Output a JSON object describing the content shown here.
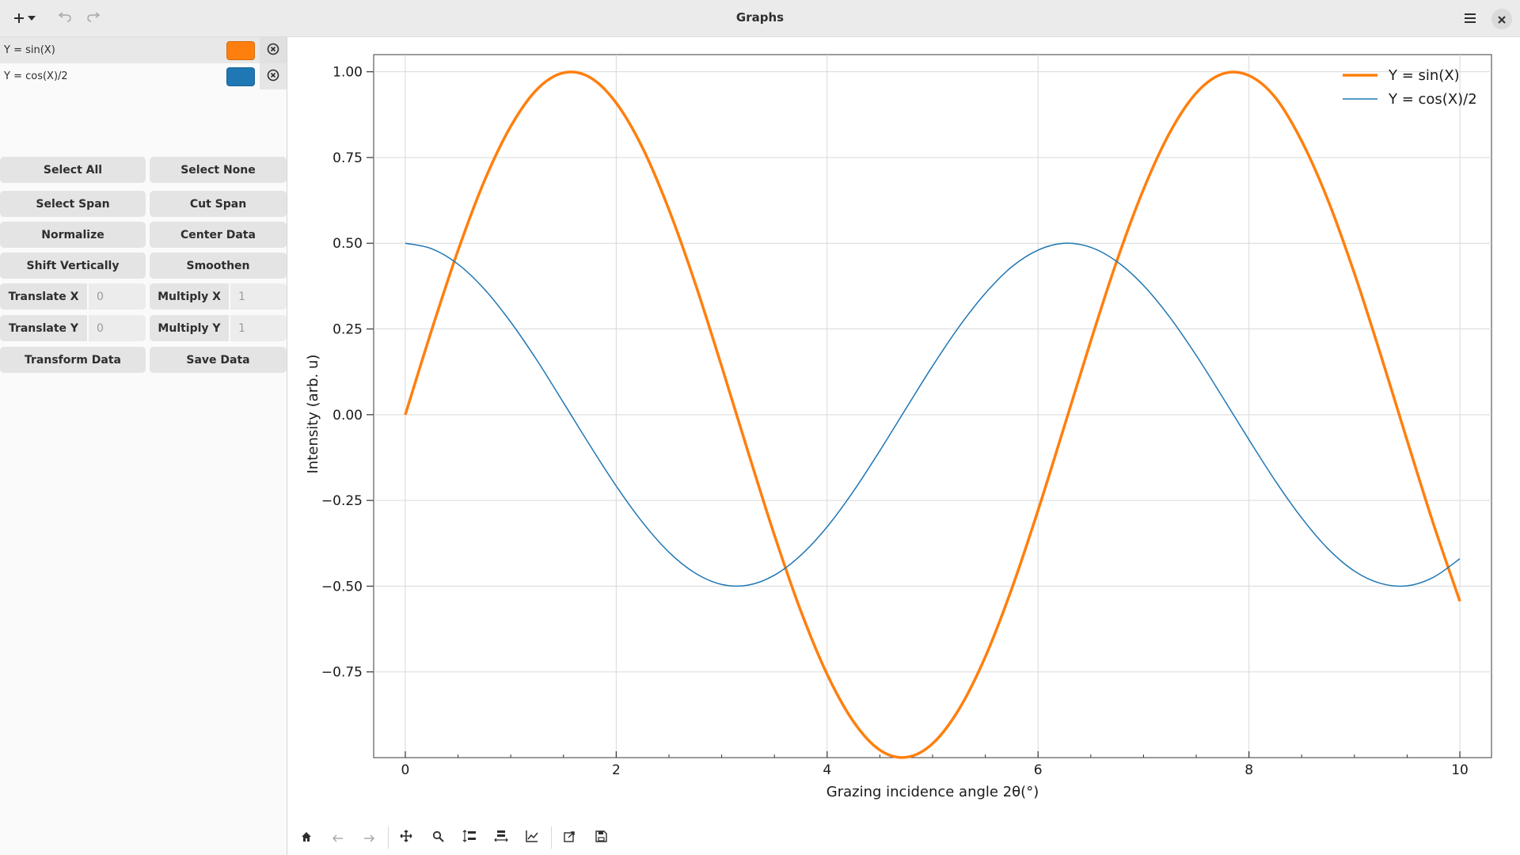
{
  "header": {
    "title": "Graphs"
  },
  "items": [
    {
      "label": "Y = sin(X)",
      "color": "#ff7f0e",
      "selected": true
    },
    {
      "label": "Y = cos(X)/2",
      "color": "#1f77b4",
      "selected": false
    }
  ],
  "operations": {
    "select_all": "Select All",
    "select_none": "Select None",
    "select_span": "Select Span",
    "cut_span": "Cut Span",
    "normalize": "Normalize",
    "center_data": "Center Data",
    "shift_vertically": "Shift Vertically",
    "smoothen": "Smoothen",
    "translate_x": "Translate X",
    "translate_x_value": "0",
    "multiply_x": "Multiply X",
    "multiply_x_value": "1",
    "translate_y": "Translate Y",
    "translate_y_value": "0",
    "multiply_y": "Multiply Y",
    "multiply_y_value": "1",
    "transform_data": "Transform Data",
    "save_data": "Save Data"
  },
  "chart_data": {
    "type": "line",
    "xlabel": "Grazing incidence angle 2θ(°)",
    "ylabel": "Intensity (arb. u)",
    "xlim": [
      -0.3,
      10.3
    ],
    "ylim": [
      -1.0,
      1.05
    ],
    "xticks": [
      0,
      2,
      4,
      6,
      8,
      10
    ],
    "xtick_labels": [
      "0",
      "2",
      "4",
      "6",
      "8",
      "10"
    ],
    "yticks": [
      -0.75,
      -0.5,
      -0.25,
      0.0,
      0.25,
      0.5,
      0.75,
      1.0
    ],
    "ytick_labels": [
      "−0.75",
      "−0.50",
      "−0.25",
      "0.00",
      "0.25",
      "0.50",
      "0.75",
      "1.00"
    ],
    "grid": true,
    "legend_position": "top-right",
    "series": [
      {
        "name": "Y = sin(X)",
        "color": "#ff7f0e",
        "x": [
          0,
          0.25,
          0.5,
          0.75,
          1,
          1.25,
          1.5,
          1.75,
          2,
          2.25,
          2.5,
          2.75,
          3,
          3.25,
          3.5,
          3.75,
          4,
          4.25,
          4.5,
          4.75,
          5,
          5.25,
          5.5,
          5.75,
          6,
          6.25,
          6.5,
          6.75,
          7,
          7.25,
          7.5,
          7.75,
          8,
          8.25,
          8.5,
          8.75,
          9,
          9.25,
          9.5,
          9.75,
          10
        ],
        "y": [
          0,
          0.247,
          0.479,
          0.682,
          0.841,
          0.949,
          0.997,
          0.984,
          0.909,
          0.778,
          0.598,
          0.382,
          0.141,
          -0.108,
          -0.351,
          -0.572,
          -0.757,
          -0.895,
          -0.978,
          -0.999,
          -0.959,
          -0.859,
          -0.706,
          -0.508,
          -0.279,
          -0.033,
          0.215,
          0.451,
          0.657,
          0.823,
          0.938,
          0.994,
          0.989,
          0.925,
          0.798,
          0.625,
          0.412,
          0.174,
          -0.075,
          -0.319,
          -0.544
        ]
      },
      {
        "name": "Y = cos(X)/2",
        "color": "#1f77b4",
        "x": [
          0,
          0.25,
          0.5,
          0.75,
          1,
          1.25,
          1.5,
          1.75,
          2,
          2.25,
          2.5,
          2.75,
          3,
          3.25,
          3.5,
          3.75,
          4,
          4.25,
          4.5,
          4.75,
          5,
          5.25,
          5.5,
          5.75,
          6,
          6.25,
          6.5,
          6.75,
          7,
          7.25,
          7.5,
          7.75,
          8,
          8.25,
          8.5,
          8.75,
          9,
          9.25,
          9.5,
          9.75,
          10
        ],
        "y": [
          0.5,
          0.484,
          0.439,
          0.366,
          0.27,
          0.158,
          0.035,
          -0.089,
          -0.208,
          -0.314,
          -0.401,
          -0.462,
          -0.495,
          -0.497,
          -0.468,
          -0.41,
          -0.327,
          -0.223,
          -0.105,
          0.019,
          0.142,
          0.256,
          0.354,
          0.431,
          0.48,
          0.5,
          0.488,
          0.446,
          0.377,
          0.284,
          0.173,
          0.051,
          -0.073,
          -0.193,
          -0.301,
          -0.391,
          -0.456,
          -0.492,
          -0.499,
          -0.474,
          -0.42
        ]
      }
    ]
  }
}
